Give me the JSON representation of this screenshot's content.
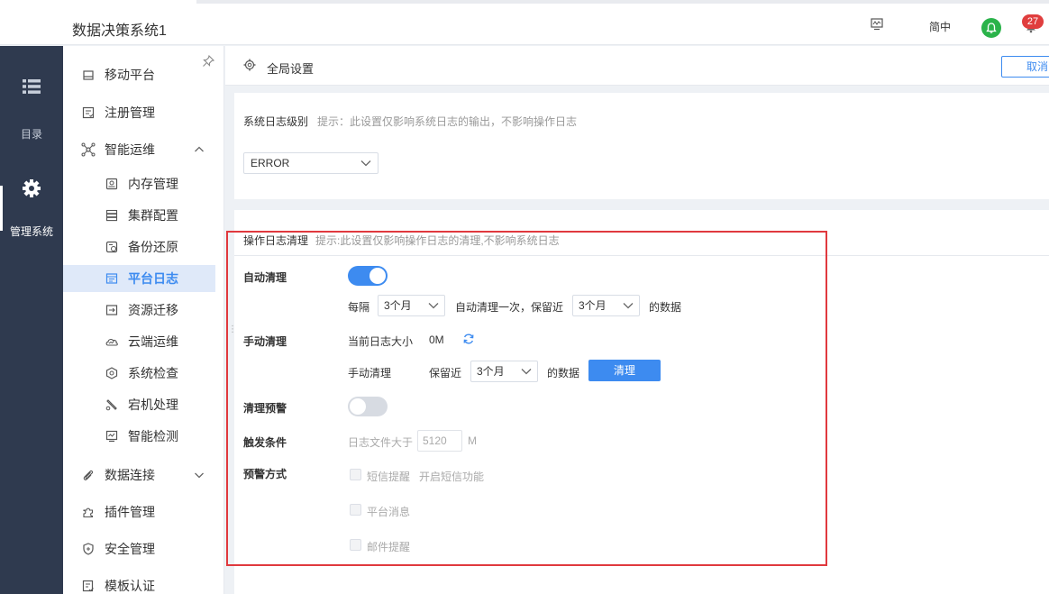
{
  "header": {
    "title": "数据决策系统1",
    "lang": "简中",
    "badge": "27"
  },
  "rail": {
    "catalog": "目录",
    "manage": "管理系统"
  },
  "sidebar": {
    "items": [
      {
        "label": "移动平台",
        "level": 1,
        "icon": "mobile-icon"
      },
      {
        "label": "注册管理",
        "level": 1,
        "icon": "register-icon"
      },
      {
        "label": "智能运维",
        "level": 1,
        "icon": "ops-icon",
        "expanded": true
      },
      {
        "label": "内存管理",
        "level": 2,
        "icon": "memory-icon"
      },
      {
        "label": "集群配置",
        "level": 2,
        "icon": "cluster-icon"
      },
      {
        "label": "备份还原",
        "level": 2,
        "icon": "backup-icon"
      },
      {
        "label": "平台日志",
        "level": 2,
        "icon": "log-icon",
        "active": true
      },
      {
        "label": "资源迁移",
        "level": 2,
        "icon": "migrate-icon"
      },
      {
        "label": "云端运维",
        "level": 2,
        "icon": "cloud-icon"
      },
      {
        "label": "系统检查",
        "level": 2,
        "icon": "check-icon"
      },
      {
        "label": "宕机处理",
        "level": 2,
        "icon": "crash-icon"
      },
      {
        "label": "智能检测",
        "level": 2,
        "icon": "detect-icon"
      },
      {
        "label": "数据连接",
        "level": 1,
        "icon": "link-icon",
        "expanded": false
      },
      {
        "label": "插件管理",
        "level": 1,
        "icon": "plugin-icon"
      },
      {
        "label": "安全管理",
        "level": 1,
        "icon": "shield-icon"
      },
      {
        "label": "模板认证",
        "level": 1,
        "icon": "template-icon"
      }
    ]
  },
  "crumb": {
    "title": "全局设置",
    "cancel": "取消"
  },
  "syslog": {
    "label": "系统日志级别",
    "hint": "提示：此设置仅影响系统日志的输出，不影响操作日志",
    "level": "ERROR"
  },
  "oplog": {
    "label": "操作日志清理",
    "hint": "提示:此设置仅影响操作日志的清理,不影响系统日志",
    "auto": {
      "label": "自动清理",
      "enabled": true,
      "every": "每隔",
      "interval": "3个月",
      "mid": "自动清理一次，保留近",
      "keep": "3个月",
      "suffix": "的数据"
    },
    "manual": {
      "label": "手动清理",
      "size_label": "当前日志大小",
      "size": "0M",
      "clean_label": "手动清理",
      "keep_label": "保留近",
      "keep": "3个月",
      "suffix": "的数据",
      "button": "清理"
    },
    "warn": {
      "label": "清理预警",
      "enabled": false
    },
    "trigger": {
      "label": "触发条件",
      "prefix": "日志文件大于",
      "value": "5120",
      "unit": "M"
    },
    "method": {
      "label": "预警方式",
      "sms": "短信提醒",
      "sms_note": "开启短信功能",
      "platform": "平台消息",
      "email": "邮件提醒"
    }
  }
}
